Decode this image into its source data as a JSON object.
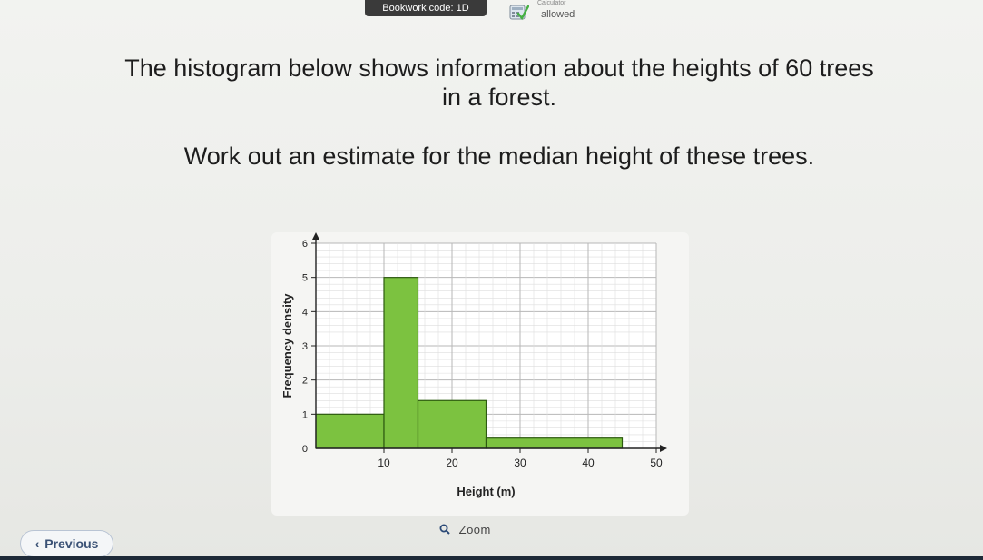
{
  "header": {
    "bookwork_label": "Bookwork code: 1D",
    "calculator_small": "Calculator",
    "calculator_status": "allowed"
  },
  "question": {
    "line1": "The histogram below shows information about the heights of 60 trees",
    "line2": "in a forest.",
    "line3": "Work out an estimate for the median height of these trees."
  },
  "controls": {
    "zoom_label": "Zoom",
    "previous_label": "Previous"
  },
  "colors": {
    "bar_fill": "#7cc240",
    "bar_stroke": "#2d5a10",
    "nav_text": "#3b5276"
  },
  "chart_data": {
    "type": "bar",
    "xlabel": "Height (m)",
    "ylabel": "Frequency density",
    "xlim": [
      0,
      50
    ],
    "ylim": [
      0,
      6
    ],
    "x_ticks": [
      10,
      20,
      30,
      40,
      50
    ],
    "y_ticks": [
      1,
      2,
      3,
      4,
      5,
      6
    ],
    "origin_label": "0",
    "grid": true,
    "bins": [
      {
        "from": 0,
        "to": 10,
        "frequency_density": 1
      },
      {
        "from": 10,
        "to": 15,
        "frequency_density": 5
      },
      {
        "from": 15,
        "to": 25,
        "frequency_density": 1.4
      },
      {
        "from": 25,
        "to": 45,
        "frequency_density": 0.3
      }
    ]
  }
}
